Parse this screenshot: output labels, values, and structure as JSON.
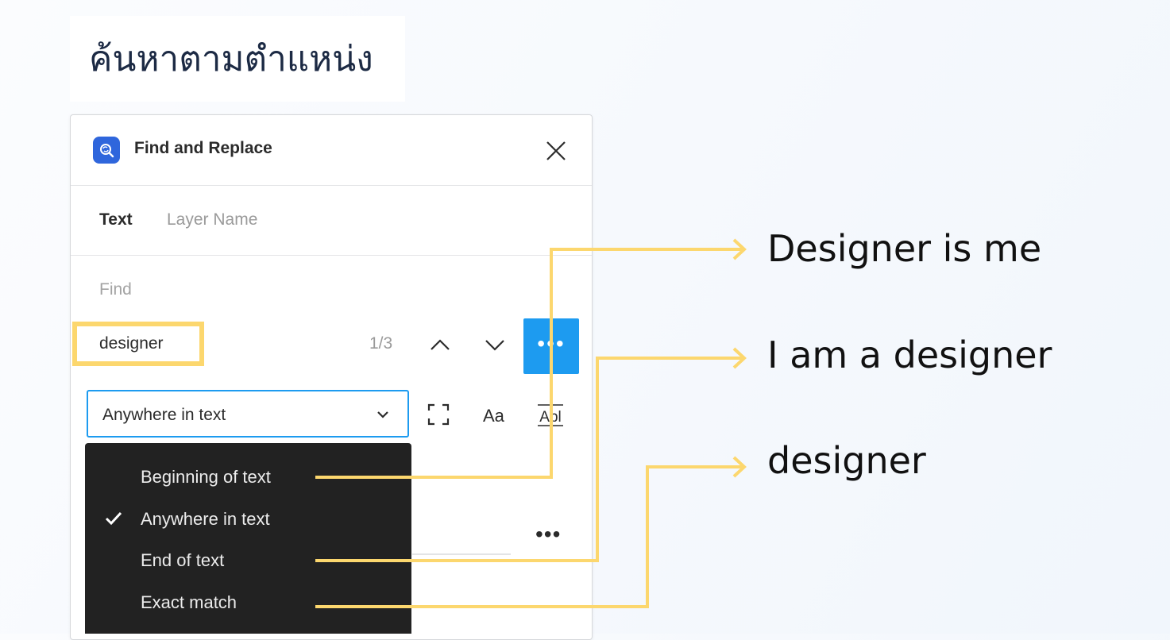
{
  "heading": "ค้นหาตามตำแหน่ง",
  "panel": {
    "title": "Find and Replace",
    "tabs": [
      "Text",
      "Layer Name"
    ],
    "find_label": "Find",
    "find_value": "designer",
    "match_count": "1/3",
    "search_mode": "Anywhere in text",
    "case_button_label": "Aa",
    "whole_word_button_label": "Abl"
  },
  "dropdown": {
    "items": [
      {
        "label": "Beginning of text",
        "checked": false
      },
      {
        "label": "Anywhere in text",
        "checked": true
      },
      {
        "label": "End of text",
        "checked": false
      },
      {
        "label": "Exact match",
        "checked": false
      }
    ]
  },
  "results": [
    "Designer is me",
    "I am a designer",
    "designer"
  ],
  "colors": {
    "accent": "#1d9bf0",
    "highlight": "#fcd76e",
    "app_icon": "#2f66dc",
    "dropdown_bg": "#222222"
  },
  "icons": {
    "app": "find-replace-icon",
    "close": "close-icon",
    "prev": "chevron-up-icon",
    "next": "chevron-down-icon",
    "more": "more-horizontal-icon",
    "select": "chevron-down-icon",
    "scope": "frame-selection-icon",
    "check": "check-icon"
  }
}
